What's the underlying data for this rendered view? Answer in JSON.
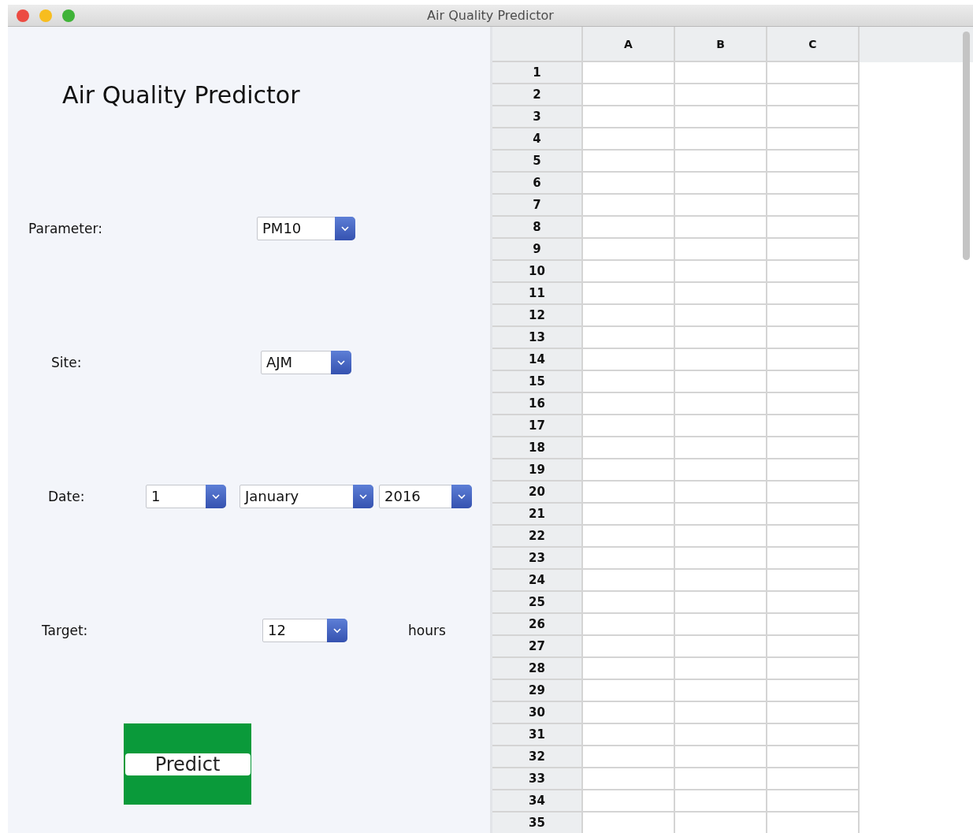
{
  "window": {
    "title": "Air Quality Predictor"
  },
  "heading": "Air Quality Predictor",
  "form": [
    {
      "label": "Parameter:",
      "combos": [
        {
          "value": "PM10"
        }
      ]
    },
    {
      "label": "Site:",
      "combos": [
        {
          "value": "AJM"
        }
      ]
    },
    {
      "label": "Date:",
      "combos": [
        {
          "value": "1"
        },
        {
          "value": "January"
        },
        {
          "value": "2016"
        }
      ]
    },
    {
      "label": "Target:",
      "combos": [
        {
          "value": "12"
        }
      ],
      "suffix": "hours"
    }
  ],
  "predict_button": "Predict",
  "table": {
    "columns": [
      "A",
      "B",
      "C"
    ],
    "rows": [
      "1",
      "2",
      "3",
      "4",
      "5",
      "6",
      "7",
      "8",
      "9",
      "10",
      "11",
      "12",
      "13",
      "14",
      "15",
      "16",
      "17",
      "18",
      "19",
      "20",
      "21",
      "22",
      "23",
      "24",
      "25",
      "26",
      "27",
      "28",
      "29",
      "30",
      "31",
      "32",
      "33",
      "34",
      "35"
    ]
  }
}
